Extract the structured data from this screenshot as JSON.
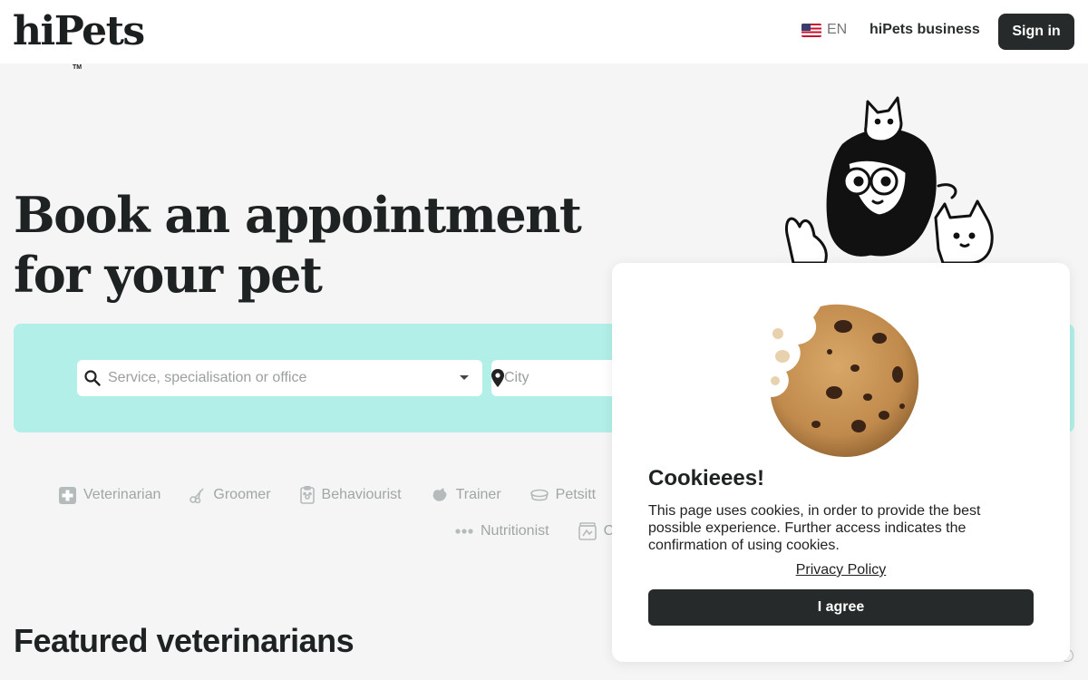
{
  "header": {
    "logo": "hiPets",
    "logo_tm": "TM",
    "language": "EN",
    "language_flag": "us-flag-icon",
    "business_link": "hiPets business",
    "signin_label": "Sign in"
  },
  "hero": {
    "title_line1": "Book an appointment",
    "title_line2": "for your pet"
  },
  "search": {
    "service_placeholder": "Service, specialisation or office",
    "city_placeholder": "City",
    "band_color": "#b2efe8"
  },
  "categories": {
    "row1": [
      {
        "label": "Veterinarian",
        "icon": "medical-cross-icon"
      },
      {
        "label": "Groomer",
        "icon": "scissors-icon"
      },
      {
        "label": "Behaviourist",
        "icon": "clipboard-paw-icon"
      },
      {
        "label": "Trainer",
        "icon": "dog-icon"
      },
      {
        "label": "Petsitt",
        "icon": "pet-bowl-icon"
      }
    ],
    "row2": [
      {
        "label": "Nutritionist",
        "icon": "dots-icon"
      },
      {
        "label": "C",
        "icon": "food-container-icon"
      }
    ]
  },
  "featured": {
    "title": "Featured veterinarians"
  },
  "cookie_modal": {
    "title": "Cookieees!",
    "text": "This page uses cookies, in order to provide the best possible experience. Further access indicates the confirmation of using cookies.",
    "privacy_link": "Privacy Policy",
    "agree_label": "I agree"
  },
  "colors": {
    "dark_button": "#262a2a",
    "background": "#f4f5f4",
    "muted_text": "#a0a6a6"
  }
}
